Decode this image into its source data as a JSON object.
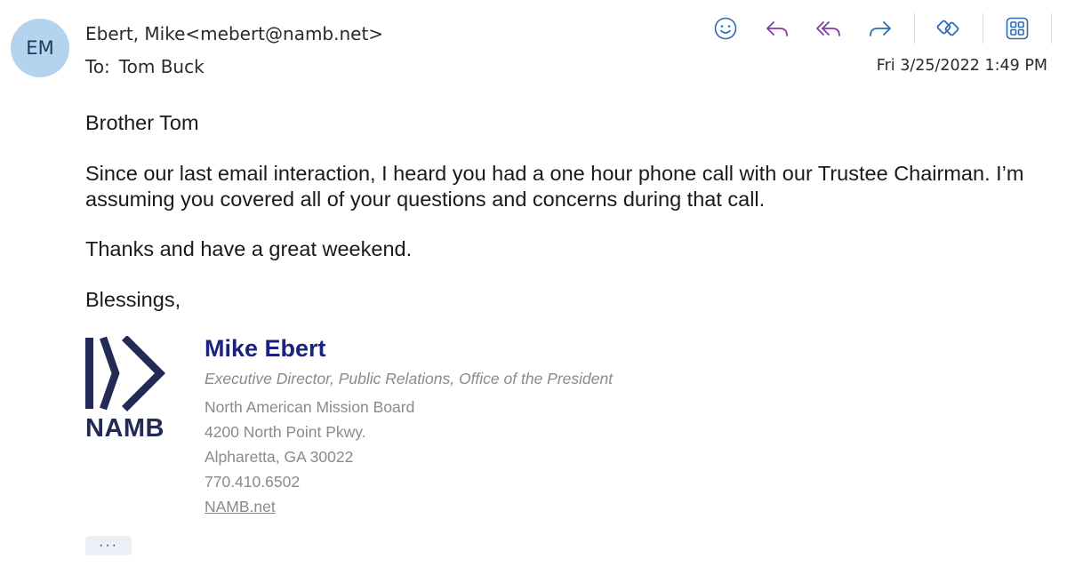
{
  "sender": {
    "initials": "EM",
    "from": "Ebert, Mike<mebert@namb.net>",
    "to_label": "To:",
    "to_name": "Tom Buck"
  },
  "date": "Fri 3/25/2022 1:49 PM",
  "toolbar": {
    "icons": [
      "emoji-icon",
      "reply-icon",
      "reply-all-icon",
      "forward-icon",
      "loop-icon",
      "apps-icon",
      "more-icon"
    ]
  },
  "colors": {
    "accent": "#2b6cb8",
    "reply_purple": "#7b3fa0",
    "avatar_bg": "#b4d3ee",
    "sig_name": "#1a237e"
  },
  "message": {
    "greeting": "Brother Tom",
    "paragraph1": "Since our last email interaction, I heard you had a one hour phone call with our Trustee Chairman. I’m assuming you covered all of your questions and concerns during that call.",
    "paragraph2": "Thanks and have a great weekend.",
    "closing": "Blessings,"
  },
  "signature": {
    "logo_text": "NAMB",
    "name": "Mike Ebert",
    "title": "Executive Director, Public Relations, Office of the President",
    "org": "North American Mission Board",
    "street": "4200 North Point Pkwy.",
    "city": "Alpharetta, GA 30022",
    "phone": "770.410.6502",
    "link": "NAMB.net"
  },
  "more_label": "···"
}
